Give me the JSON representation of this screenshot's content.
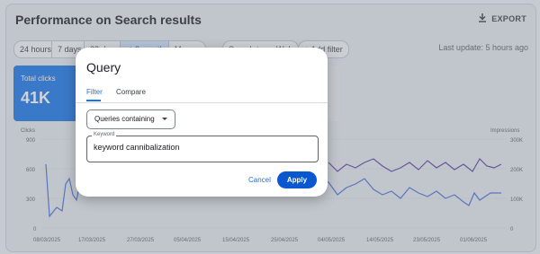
{
  "report": {
    "title": "Performance on Search results",
    "export_label": "EXPORT",
    "last_update": "Last update: 5 hours ago"
  },
  "filters": {
    "ranges": [
      "24 hours",
      "7 days",
      "28 days",
      "✓ 3 months",
      "More ▾"
    ],
    "search_type": "Search type: Web",
    "add_filter": "+ Add filter"
  },
  "metric_card": {
    "label": "Total clicks",
    "value": "41K"
  },
  "dialog": {
    "title": "Query",
    "tabs": [
      "Filter",
      "Compare"
    ],
    "dropdown_value": "Queries containing",
    "keyword_label": "Keyword",
    "keyword_value": "keyword cannibalization",
    "cancel_label": "Cancel",
    "apply_label": "Apply"
  },
  "chart_data": {
    "type": "line",
    "left_axis_label": "Clicks",
    "right_axis_label": "Impressions",
    "left_ticks": [
      "900",
      "600",
      "300",
      "0"
    ],
    "right_ticks": [
      "300K",
      "200K",
      "100K",
      "0"
    ],
    "x_ticks": [
      "08/03/2025",
      "17/03/2025",
      "27/03/2025",
      "05/04/2025",
      "15/04/2025",
      "25/04/2025",
      "04/05/2025",
      "14/05/2025",
      "23/05/2025",
      "01/06/2025"
    ],
    "colors": {
      "clicks": "#4a6fd6",
      "impressions": "#5b3ea6"
    }
  }
}
